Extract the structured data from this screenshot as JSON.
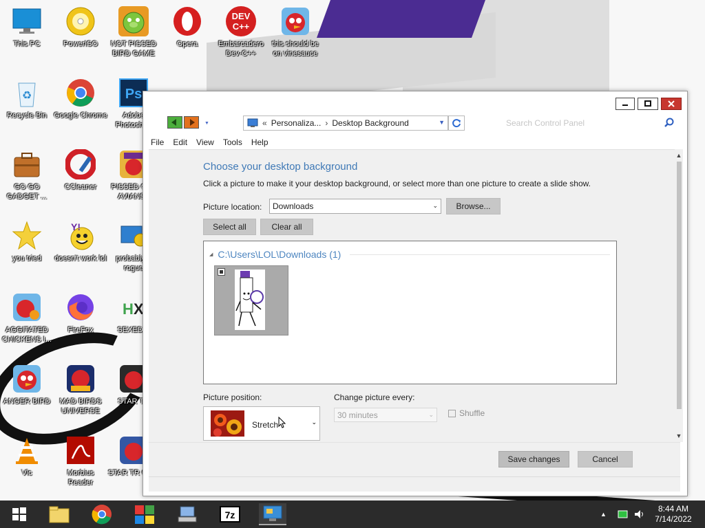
{
  "desktop": {
    "icons": [
      {
        "name": "This PC"
      },
      {
        "name": "PowerISO"
      },
      {
        "name": "NOT PISSED BIRD GAME"
      },
      {
        "name": "Opera"
      },
      {
        "name": "Embarcadero Dev-C++"
      },
      {
        "name": "this should be on vinesauce"
      },
      {
        "name": "Recycle Bin"
      },
      {
        "name": "Google Chrome"
      },
      {
        "name": "Adobe Photoshop"
      },
      {
        "name": "GO GO GADGET ..."
      },
      {
        "name": "CCleaner"
      },
      {
        "name": "PISSED OFF AVIANS I"
      },
      {
        "name": "you tried"
      },
      {
        "name": "doesn't work lol"
      },
      {
        "name": "probably a rogue"
      },
      {
        "name": "AGGITATED CHICKENS I..."
      },
      {
        "name": "FireFox"
      },
      {
        "name": "SEXEDIT"
      },
      {
        "name": "ANGER BIRD"
      },
      {
        "name": "MAD BIRDS UNIVERSE"
      },
      {
        "name": "STAR TR"
      },
      {
        "name": "Vlc"
      },
      {
        "name": "Morbius Reader"
      },
      {
        "name": "STAR TR GAM"
      }
    ]
  },
  "window": {
    "address": {
      "crumb1": "Personaliza...",
      "crumb2": "Desktop Background"
    },
    "search_placeholder": "Search Control Panel",
    "menu": [
      "File",
      "Edit",
      "View",
      "Tools",
      "Help"
    ],
    "heading": "Choose your desktop background",
    "description": "Click a picture to make it your desktop background, or select more than one picture to create a slide show.",
    "picture_location": {
      "label": "Picture location:",
      "value": "Downloads",
      "browse_label": "Browse..."
    },
    "select_all_label": "Select all",
    "clear_all_label": "Clear all",
    "group_header": "C:\\Users\\LOL\\Downloads (1)",
    "picture_position": {
      "label": "Picture position:",
      "value": "Stretch"
    },
    "change_picture": {
      "label": "Change picture every:",
      "value": "30 minutes"
    },
    "shuffle_label": "Shuffle",
    "save_label": "Save changes",
    "cancel_label": "Cancel"
  },
  "taskbar": {
    "time": "8:44 AM",
    "date": "7/14/2022",
    "apps": [
      "file-explorer",
      "google-chrome",
      "windows-logo-app",
      "network-computer",
      "7-zip",
      "control-panel"
    ]
  },
  "colors": {
    "heading_blue": "#3f79b6",
    "close_red": "#c7372f",
    "taskbar": "#2b2b2b"
  }
}
